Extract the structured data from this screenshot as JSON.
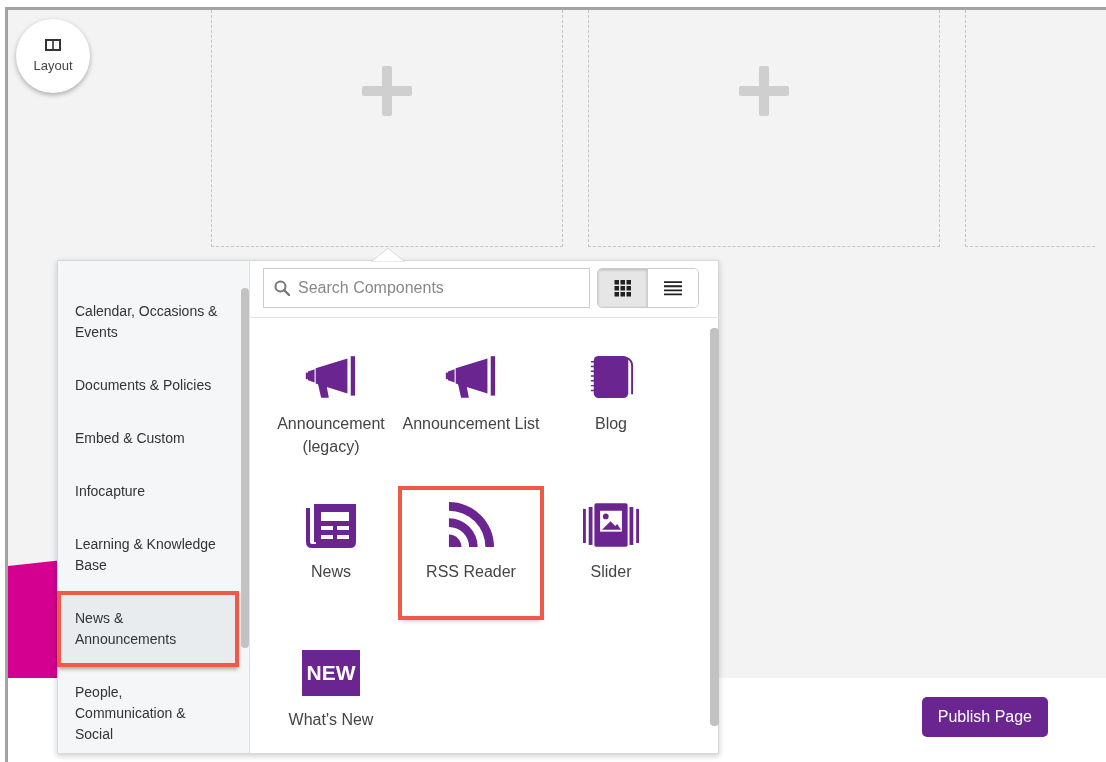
{
  "layout_button": {
    "label": "Layout"
  },
  "slots": [
    {
      "kind": "empty",
      "add": true
    },
    {
      "kind": "empty",
      "add": true
    },
    {
      "kind": "empty",
      "add": false
    }
  ],
  "picker": {
    "categories": [
      {
        "label": "Calendar, Occasions & Events",
        "selected": false
      },
      {
        "label": "Documents & Policies",
        "selected": false
      },
      {
        "label": "Embed & Custom",
        "selected": false
      },
      {
        "label": "Infocapture",
        "selected": false
      },
      {
        "label": "Learning & Knowledge Base",
        "selected": false
      },
      {
        "label": "News & Announcements",
        "selected": true
      },
      {
        "label": "People, Communication & Social",
        "selected": false
      }
    ],
    "search": {
      "placeholder": "Search Components"
    },
    "views": [
      {
        "kind": "grid",
        "selected": true
      },
      {
        "kind": "list",
        "selected": false
      }
    ],
    "components": [
      {
        "label": "Announcement (legacy)",
        "kind": "megaphone",
        "highlighted": false
      },
      {
        "label": "Announcement List",
        "kind": "megaphone",
        "highlighted": false
      },
      {
        "label": "Blog",
        "kind": "notebook",
        "highlighted": false
      },
      {
        "label": "News",
        "kind": "newspaper",
        "highlighted": false
      },
      {
        "label": "RSS Reader",
        "kind": "rss",
        "highlighted": true
      },
      {
        "label": "Slider",
        "kind": "gallery",
        "highlighted": false
      },
      {
        "label": "What's New",
        "kind": "badge",
        "badge_text": "NEW",
        "highlighted": false
      }
    ]
  },
  "publish_button": {
    "label": "Publish Page"
  }
}
